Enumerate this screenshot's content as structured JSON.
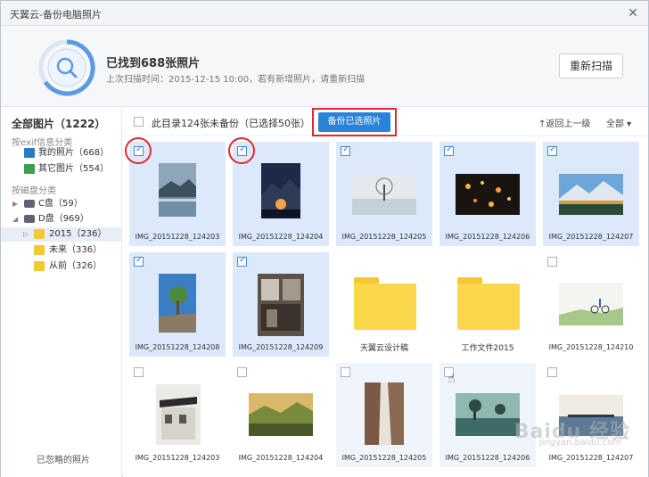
{
  "window": {
    "title": "天翼云-备份电脑照片",
    "close_glyph": "✕"
  },
  "header": {
    "found_text": "已找到688张照片",
    "subline": "上次扫描时间：2015-12-15 10:00，若有新增照片，请重新扫描",
    "rescan_label": "重新扫描"
  },
  "sidebar": {
    "all_label": "全部图片（1222）",
    "section_exif": "按exif信息分类",
    "my_photos": "我的照片（668）",
    "other_photos": "其它图片（554）",
    "section_disk": "按磁盘分类",
    "drive_c": "C盘（59）",
    "drive_d": "D盘（969）",
    "folder_2015": "2015（236）",
    "folder_future": "未来（336）",
    "folder_past": "从前（326）",
    "ignored": "已忽略的照片"
  },
  "toolbar": {
    "status_text": "此目录124张未备份（已选择50张）",
    "backup_selected_label": "备份已选照片",
    "back_label": "↑返回上一级",
    "filter_label": "全部 ▾"
  },
  "tiles": [
    {
      "caption": "IMG_20151228_124203",
      "checked": true
    },
    {
      "caption": "IMG_20151228_124204",
      "checked": true
    },
    {
      "caption": "IMG_20151228_124205",
      "checked": true
    },
    {
      "caption": "IMG_20151228_124206",
      "checked": true
    },
    {
      "caption": "IMG_20151228_124207",
      "checked": true
    },
    {
      "caption": "IMG_20151228_124208",
      "checked": true
    },
    {
      "caption": "IMG_20151228_124209",
      "checked": true
    },
    {
      "caption": "天翼云设计稿",
      "checked": false
    },
    {
      "caption": "工作文件2015",
      "checked": false
    },
    {
      "caption": "IMG_20151228_124210",
      "checked": false
    },
    {
      "caption": "IMG_20151228_124203",
      "checked": false
    },
    {
      "caption": "IMG_20151228_124204",
      "checked": false
    },
    {
      "caption": "IMG_20151228_124205",
      "checked": false
    },
    {
      "caption": "IMG_20151228_124206",
      "checked": false
    },
    {
      "caption": "IMG_20151228_124207",
      "checked": false
    }
  ],
  "watermark": {
    "brand": "Baidu 经验",
    "sub": "jingyan.baidu.com"
  },
  "colors": {
    "accent": "#2b83d8",
    "highlight_red": "#e0282e",
    "selected_bg": "#dce9fb"
  }
}
